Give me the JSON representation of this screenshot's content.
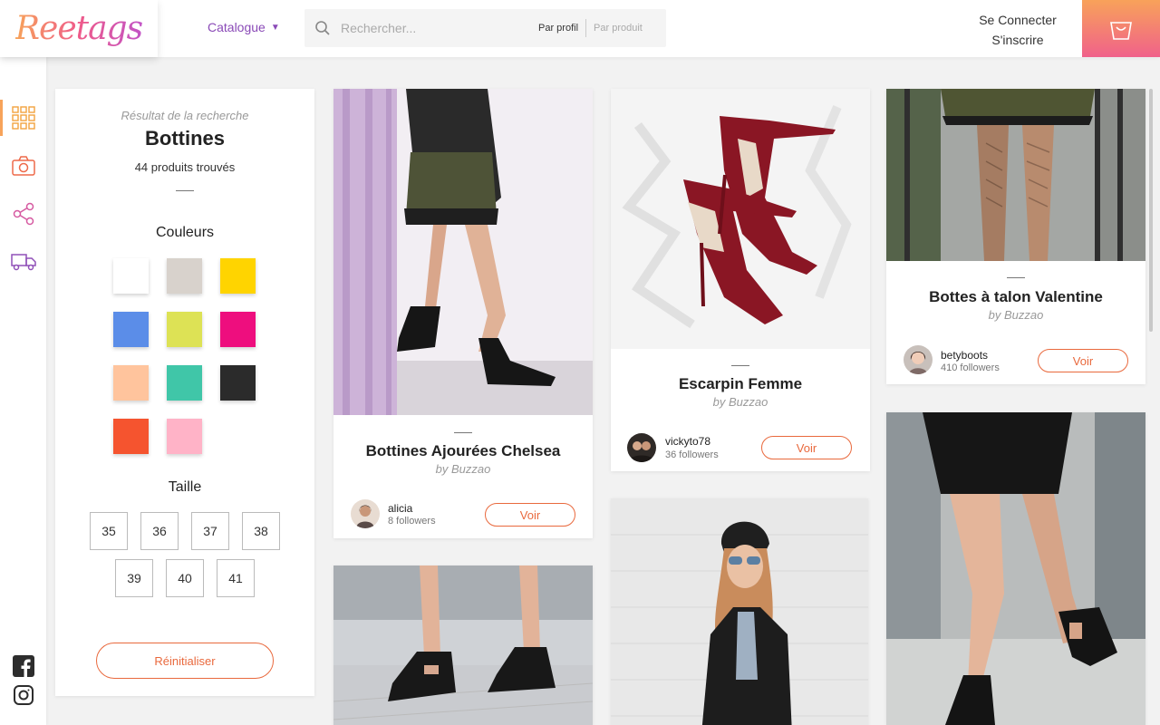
{
  "header": {
    "logo": "Reetags",
    "catalogue_label": "Catalogue",
    "search_placeholder": "Rechercher...",
    "search_mode_profile": "Par profil",
    "search_mode_product": "Par produit",
    "login_label": "Se Connecter",
    "signup_label": "S'inscrire"
  },
  "rail": {
    "items": [
      {
        "icon": "grid-icon",
        "active": true
      },
      {
        "icon": "camera-icon",
        "active": false
      },
      {
        "icon": "share-icon",
        "active": false
      },
      {
        "icon": "truck-icon",
        "active": false
      }
    ],
    "social": [
      "facebook-icon",
      "instagram-icon"
    ]
  },
  "filters": {
    "kicker": "Résultat de la recherche",
    "title": "Bottines",
    "count": "44 produits trouvés",
    "colors_title": "Couleurs",
    "colors": [
      "#ffffff",
      "#d8d2cc",
      "#ffd400",
      "#5b8de8",
      "#dde255",
      "#ee0e7e",
      "#ffc49d",
      "#40c6a8",
      "#2b2b2b",
      "#f5542f",
      "#ffb3c7"
    ],
    "size_title": "Taille",
    "sizes": [
      "35",
      "36",
      "37",
      "38",
      "39",
      "40",
      "41"
    ],
    "reset_label": "Réinitialiser"
  },
  "products": [
    {
      "title": "Bottines Ajourées Chelsea",
      "by": "by Buzzao",
      "user": "alicia",
      "followers": "8 followers",
      "cta": "Voir"
    },
    {
      "title": "Escarpin Femme",
      "by": "by Buzzao",
      "user": "vickyto78",
      "followers": "36 followers",
      "cta": "Voir"
    },
    {
      "title": "Bottes à talon Valentine",
      "by": "by Buzzao",
      "user": "betyboots",
      "followers": "410 followers",
      "cta": "Voir"
    }
  ]
}
